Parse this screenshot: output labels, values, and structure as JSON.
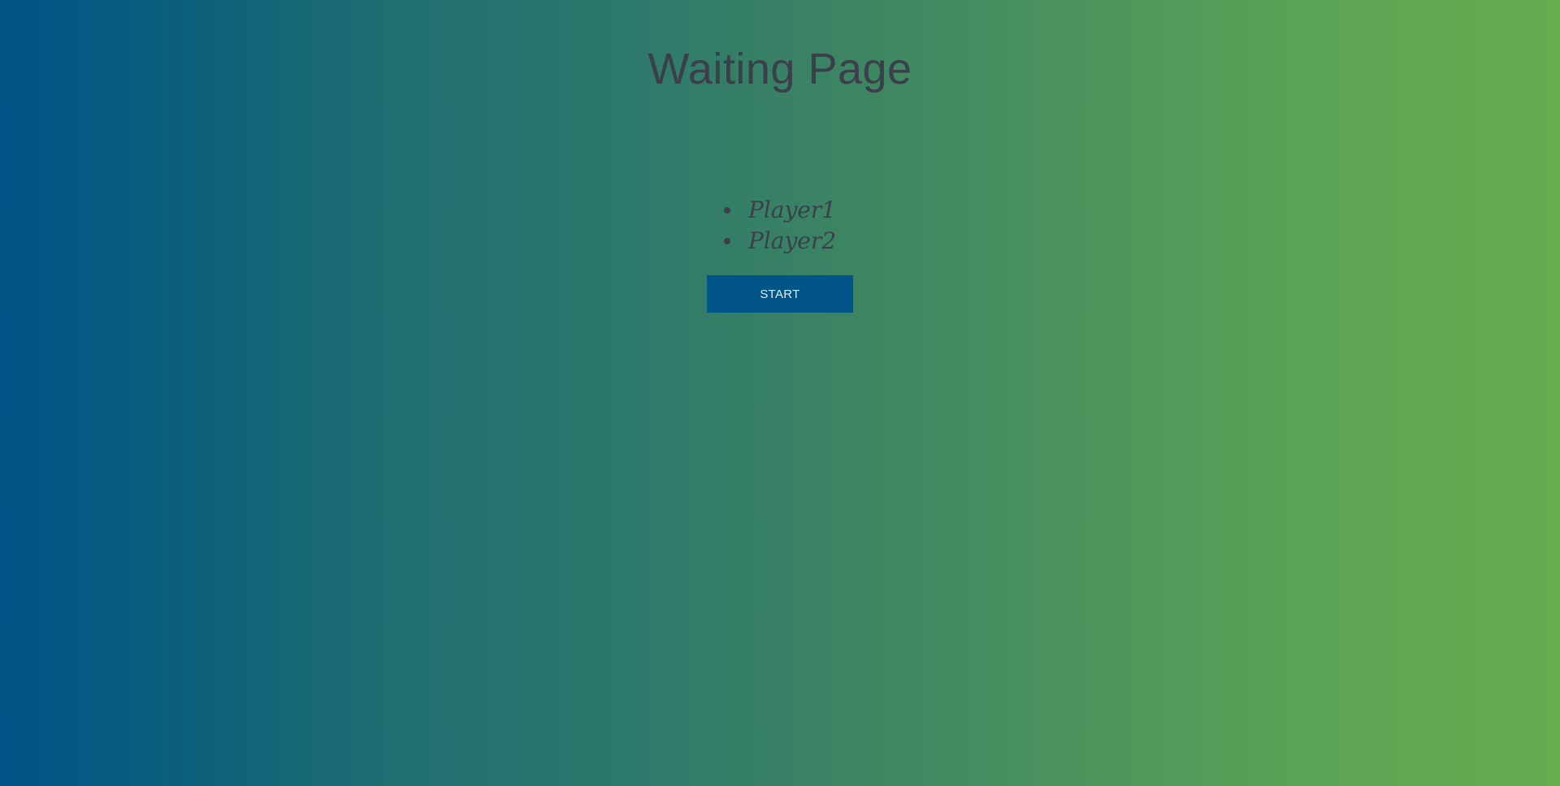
{
  "page": {
    "title": "Waiting Page"
  },
  "players": [
    {
      "name": "Player1"
    },
    {
      "name": "Player2"
    }
  ],
  "actions": {
    "start_label": "START"
  },
  "colors": {
    "gradient_start": "#005487",
    "gradient_end": "#66ad4f",
    "button_bg": "#005487",
    "text": "#3a3f4a"
  }
}
